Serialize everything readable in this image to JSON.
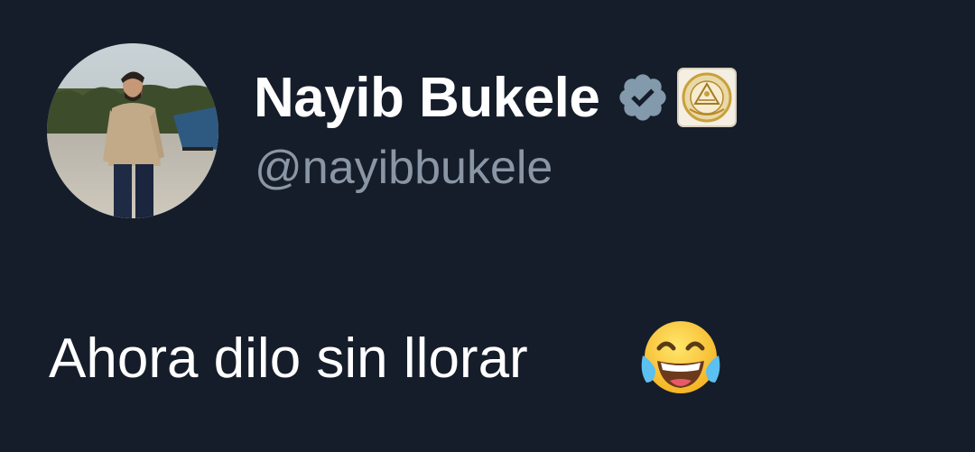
{
  "tweet": {
    "author": {
      "display_name": "Nayib Bukele",
      "handle": "@nayibbukele",
      "verified_badge_icon": "verified-checkmark-icon",
      "affiliate_badge_icon": "el-salvador-coat-of-arms-icon",
      "avatar_icon": "profile-photo"
    },
    "text": "Ahora dilo sin llorar",
    "emoji_icon": "face-with-tears-of-joy-icon"
  },
  "colors": {
    "background": "#151d2a",
    "name": "#ffffff",
    "handle": "#8a96a5",
    "verified": "#829aab",
    "badge_gold": "#c9a13a"
  }
}
